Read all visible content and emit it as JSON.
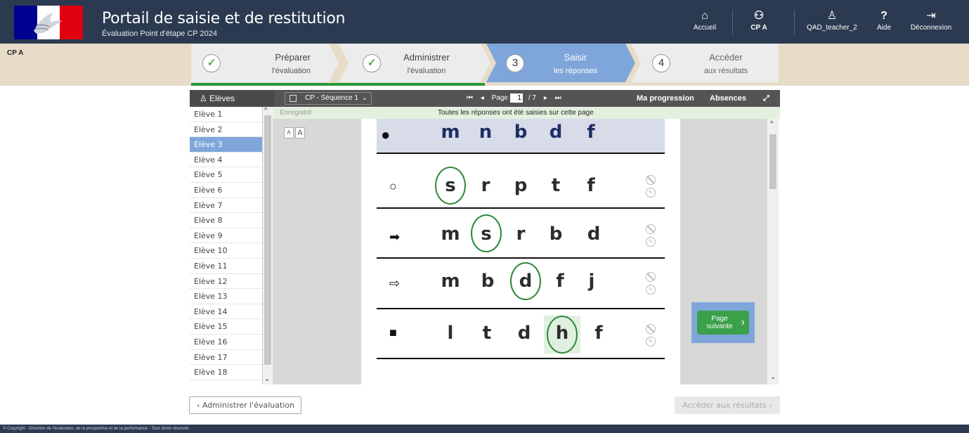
{
  "header": {
    "title": "Portail de saisie et de restitution",
    "subtitle": "Évaluation Point d'étape CP 2024",
    "nav": [
      {
        "icon": "home-icon",
        "label": "Accueil"
      },
      {
        "icon": "class-icon",
        "label": "CP A"
      },
      {
        "icon": "user-icon",
        "label": "QAD_teacher_2"
      },
      {
        "icon": "help-icon",
        "label": "Aide"
      },
      {
        "icon": "logout-icon",
        "label": "Déconnexion"
      }
    ],
    "glyphs": {
      "home": "⌂",
      "class": "⚇",
      "user": "♙",
      "help": "?",
      "logout": "⇥"
    }
  },
  "class_label": "CP A",
  "steps": [
    {
      "state": "done",
      "marker": "✓",
      "line1": "Préparer",
      "line2": "l'évaluation"
    },
    {
      "state": "done",
      "marker": "✓",
      "line1": "Administrer",
      "line2": "l'évaluation"
    },
    {
      "state": "active",
      "marker": "3",
      "line1": "Saisir",
      "line2": "les réponses"
    },
    {
      "state": "todo",
      "marker": "4",
      "line1": "Accéder",
      "line2": "aux résultats"
    }
  ],
  "toolbar": {
    "students_header": "Elèves",
    "sequence": "CP - Séquence 1",
    "page_label": "Page",
    "page_current": "1",
    "page_total": "/ 7",
    "progress_link": "Ma progression",
    "absences_link": "Absences",
    "expand_icon": "⤢",
    "first": "⏮",
    "prev": "◂",
    "next": "▸",
    "last": "⏭"
  },
  "status": {
    "saved": "Enregistré",
    "message": "Toutes les réponses ont été saisies sur cette page"
  },
  "font_buttons": [
    "A",
    "A"
  ],
  "students": [
    "Elève 1",
    "Elève 2",
    "Elève 3",
    "Elève 4",
    "Elève 5",
    "Elève 6",
    "Elève 7",
    "Elève 8",
    "Elève 9",
    "Elève 10",
    "Elève 11",
    "Elève 12",
    "Elève 13",
    "Elève 14",
    "Elève 15",
    "Elève 16",
    "Elève 17",
    "Elève 18"
  ],
  "selected_student": "Elève 3",
  "exercise": {
    "example": {
      "symbol": "●",
      "letters": [
        "m",
        "n",
        "b",
        "d",
        "f"
      ]
    },
    "rows": [
      {
        "symbol": "○",
        "letters": [
          "s",
          "r",
          "p",
          "t",
          "f"
        ],
        "selected": 0
      },
      {
        "symbol": "➡",
        "letters": [
          "m",
          "s",
          "r",
          "b",
          "d"
        ],
        "selected": 1
      },
      {
        "symbol": "⇨",
        "letters": [
          "m",
          "b",
          "d",
          "f",
          "j"
        ],
        "selected": 2
      },
      {
        "symbol": "■",
        "letters": [
          "l",
          "t",
          "d",
          "h",
          "f"
        ],
        "selected": 3
      }
    ]
  },
  "next_page": {
    "line1": "Page",
    "line2": "suivante",
    "chevron": "›"
  },
  "footer_buttons": {
    "prev": "‹  Administrer l'évaluation",
    "next": "Accéder aux résultats  ›"
  },
  "footer_text": "© Copyright - Direction de l'évaluation, de la prospective et de la performance - Tous droits réservés"
}
